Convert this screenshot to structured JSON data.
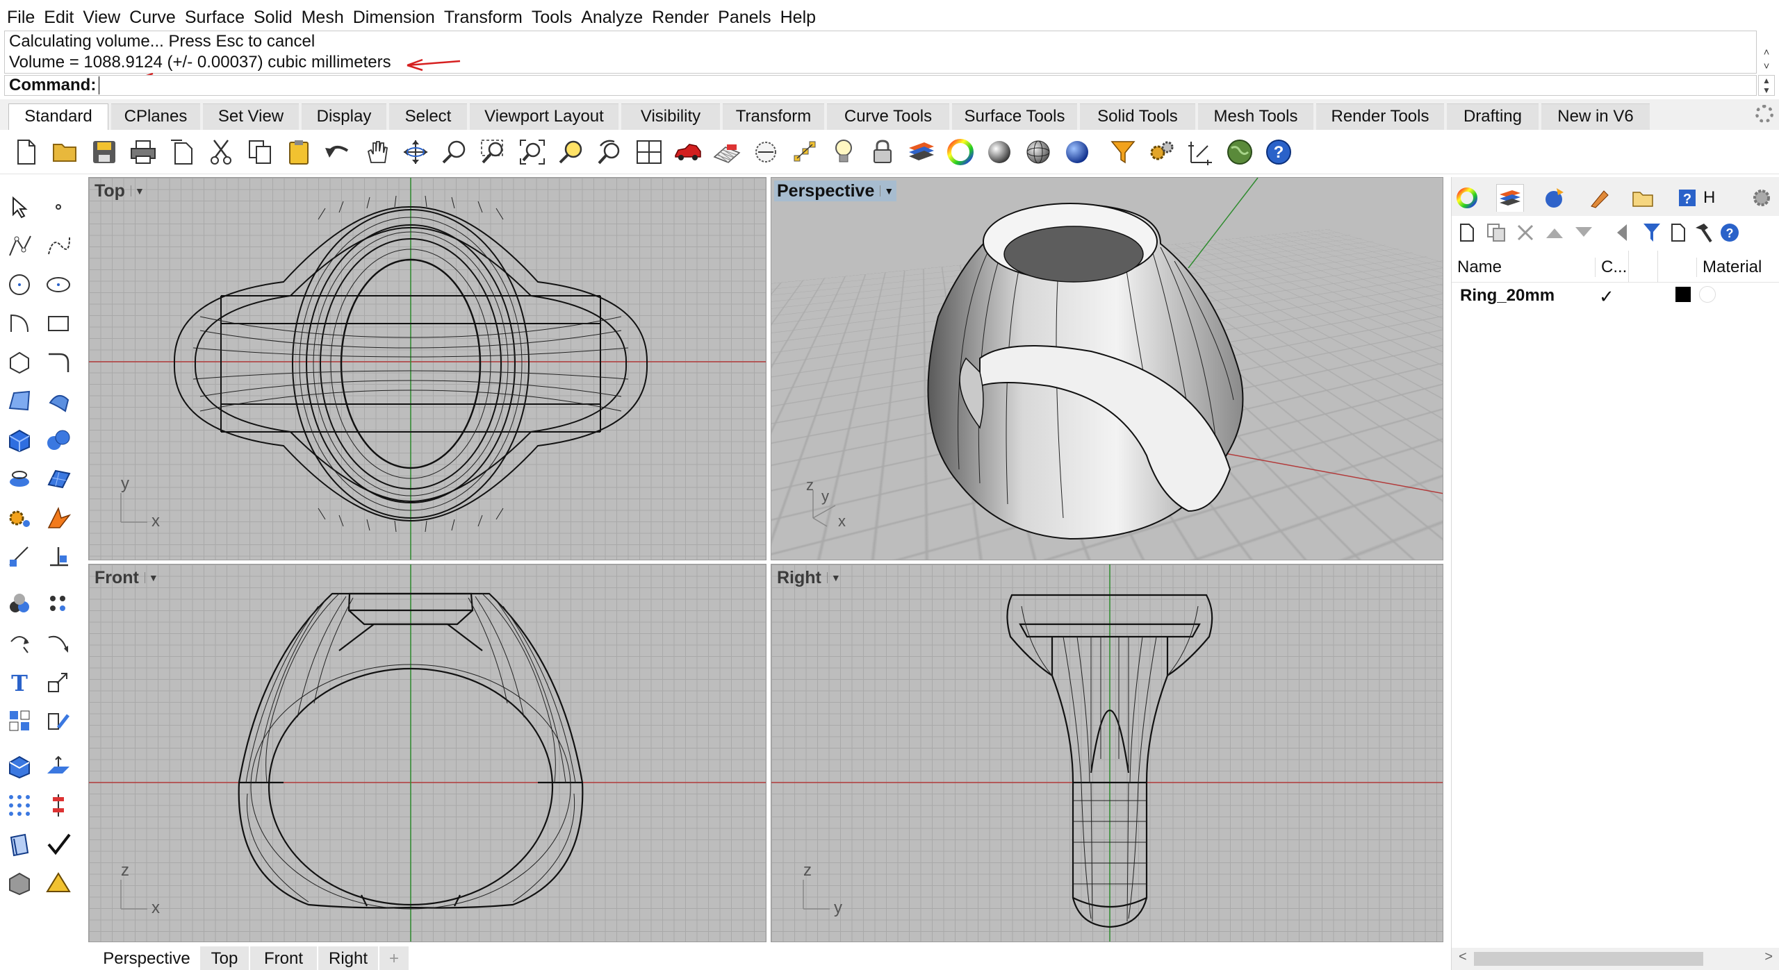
{
  "menu": [
    "File",
    "Edit",
    "View",
    "Curve",
    "Surface",
    "Solid",
    "Mesh",
    "Dimension",
    "Transform",
    "Tools",
    "Analyze",
    "Render",
    "Panels",
    "Help"
  ],
  "command_history": {
    "line1": "Calculating volume... Press Esc to cancel",
    "line2": "Volume = 1088.9124 (+/- 0.00037) cubic millimeters"
  },
  "command": {
    "label": "Command:",
    "value": ""
  },
  "toolbar_tabs": [
    "Standard",
    "CPlanes",
    "Set View",
    "Display",
    "Select",
    "Viewport Layout",
    "Visibility",
    "Transform",
    "Curve Tools",
    "Surface Tools",
    "Solid Tools",
    "Mesh Tools",
    "Render Tools",
    "Drafting",
    "New in V6"
  ],
  "toolbar_icons": [
    "new-icon",
    "open-icon",
    "save-icon",
    "print-icon",
    "import-icon",
    "cut-icon",
    "copy-icon",
    "paste-icon",
    "undo-icon",
    "pan-icon",
    "rotate-view-icon",
    "zoom-icon",
    "zoom-window-icon",
    "zoom-extents-icon",
    "zoom-selected-icon",
    "undo-view-icon",
    "four-viewports-icon",
    "car-icon",
    "grid-icon",
    "cplane-icon",
    "snap-icon",
    "light-icon",
    "lock-icon",
    "layer-icon",
    "color-wheel-icon",
    "shaded-sphere-icon",
    "wireframe-sphere-icon",
    "render-sphere-icon",
    "filter-icon",
    "settings-gears-icon",
    "dimension-icon",
    "earth-icon",
    "help-icon"
  ],
  "viewports": {
    "top": "Top",
    "perspective": "Perspective",
    "front": "Front",
    "right": "Right"
  },
  "axis_labels": {
    "x": "x",
    "y": "y",
    "z": "z"
  },
  "viewport_tabs": [
    "Perspective",
    "Top",
    "Front",
    "Right"
  ],
  "layers_panel": {
    "columns": {
      "name": "Name",
      "current": "C...",
      "material": "Material"
    },
    "rows": [
      {
        "name": "Ring_20mm",
        "current": "✓",
        "color": "#000000"
      }
    ],
    "tab_label_h": "H"
  },
  "colors": {
    "active_viewport_title": "#a7bccf",
    "x_axis": "#b23a3a",
    "y_axis": "#2e8b2e",
    "annotation": "#d62020"
  }
}
